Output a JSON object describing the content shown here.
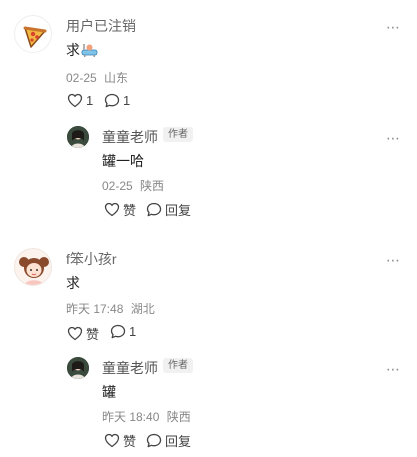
{
  "comments": [
    {
      "username": "用户已注销",
      "text": "求",
      "emoji": "bathtub-emoji",
      "date": "02-25",
      "location": "山东",
      "likes": "1",
      "replies_count": "1",
      "reply": {
        "username": "童童老师",
        "tag": "作者",
        "text": "罐一哈",
        "date": "02-25",
        "location": "陕西",
        "like_label": "赞",
        "reply_label": "回复"
      }
    },
    {
      "username": "f笨小孩r",
      "text": "求",
      "date": "昨天 17:48",
      "location": "湖北",
      "like_label": "赞",
      "replies_count": "1",
      "reply": {
        "username": "童童老师",
        "tag": "作者",
        "text": "罐",
        "date": "昨天 18:40",
        "location": "陕西",
        "like_label": "赞",
        "reply_label": "回复"
      }
    }
  ],
  "more_label": "⋯",
  "icons": {
    "heart": "heart-icon",
    "comment": "comment-icon",
    "more": "more-icon"
  },
  "colors": {
    "primary_text": "#222222",
    "secondary_text": "#888888",
    "tag_bg": "#f1f1f1"
  }
}
